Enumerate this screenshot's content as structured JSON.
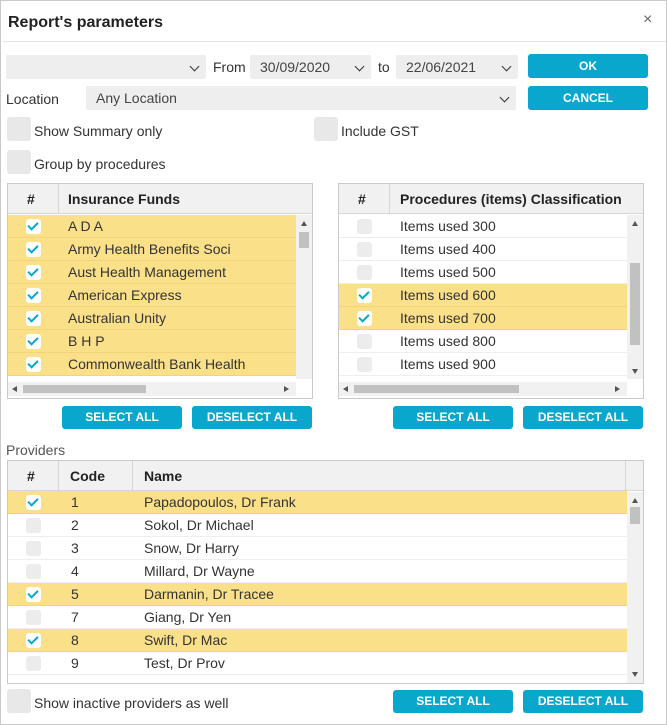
{
  "dialog": {
    "title": "Report's parameters",
    "close_glyph": "×"
  },
  "filters": {
    "type_value": "",
    "from_label": "From",
    "from_date": "30/09/2020",
    "to_label": "to",
    "to_date": "22/06/2021",
    "location_label": "Location",
    "location_value": "Any Location"
  },
  "buttons": {
    "ok": "OK",
    "cancel": "CANCEL",
    "select_all": "SELECT ALL",
    "deselect_all": "DESELECT ALL"
  },
  "options": {
    "show_summary": "Show Summary only",
    "include_gst": "Include GST",
    "group_by_procedures": "Group by procedures",
    "show_inactive": "Show inactive providers as well"
  },
  "insurance": {
    "col_hash": "#",
    "col_name": "Insurance Funds",
    "rows": [
      {
        "name": "A D A",
        "checked": true
      },
      {
        "name": "Army Health Benefits Soci",
        "checked": true
      },
      {
        "name": "Aust Health Management",
        "checked": true
      },
      {
        "name": "American Express",
        "checked": true
      },
      {
        "name": "Australian Unity",
        "checked": true
      },
      {
        "name": "B H P",
        "checked": true
      },
      {
        "name": "Commonwealth Bank Health",
        "checked": true
      }
    ]
  },
  "procedures": {
    "col_hash": "#",
    "col_name": "Procedures (items) Classification",
    "rows": [
      {
        "name": "Items used 300",
        "checked": false
      },
      {
        "name": "Items used 400",
        "checked": false
      },
      {
        "name": "Items used 500",
        "checked": false
      },
      {
        "name": "Items used 600",
        "checked": true
      },
      {
        "name": "Items used 700",
        "checked": true
      },
      {
        "name": "Items used 800",
        "checked": false
      },
      {
        "name": "Items used 900",
        "checked": false
      }
    ]
  },
  "providers": {
    "section_label": "Providers",
    "col_hash": "#",
    "col_code": "Code",
    "col_name": "Name",
    "rows": [
      {
        "code": "1",
        "name": "Papadopoulos, Dr Frank",
        "checked": true
      },
      {
        "code": "2",
        "name": "Sokol, Dr Michael",
        "checked": false
      },
      {
        "code": "3",
        "name": "Snow, Dr Harry",
        "checked": false
      },
      {
        "code": "4",
        "name": "Millard, Dr Wayne",
        "checked": false
      },
      {
        "code": "5",
        "name": "Darmanin, Dr Tracee",
        "checked": true
      },
      {
        "code": "7",
        "name": "Giang, Dr Yen",
        "checked": false
      },
      {
        "code": "8",
        "name": "Swift, Dr Mac",
        "checked": true
      },
      {
        "code": "9",
        "name": "Test, Dr Prov",
        "checked": false
      }
    ]
  },
  "colors": {
    "accent": "#0aa7cc",
    "selected_row": "#fbe08a"
  }
}
